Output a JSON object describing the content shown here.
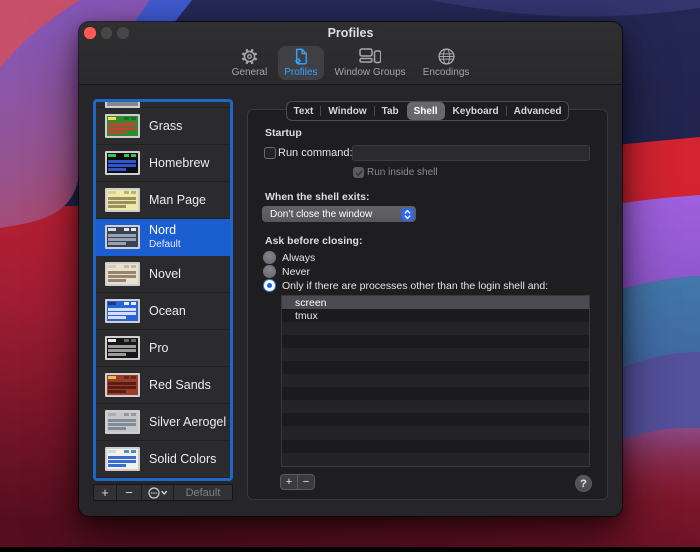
{
  "window": {
    "title": "Profiles"
  },
  "toolbar": {
    "accent_color": "#35a5ff",
    "items": [
      {
        "label": "General",
        "icon": "gear-icon",
        "selected": false
      },
      {
        "label": "Profiles",
        "icon": "profiles-doc-icon",
        "selected": true
      },
      {
        "label": "Window Groups",
        "icon": "window-groups-icon",
        "selected": false
      },
      {
        "label": "Encodings",
        "icon": "globe-icon",
        "selected": false
      }
    ]
  },
  "sidebar": {
    "selection_color": "#1b5ed2",
    "focus_ring_color": "#1e66c9",
    "profiles": [
      {
        "name": "Grass",
        "selected": false,
        "thumb": {
          "bg": "#2e8b33",
          "stripe": "#c0452e",
          "pill": "#ffe14a",
          "chip": "#1f6f24"
        }
      },
      {
        "name": "Homebrew",
        "selected": false,
        "thumb": {
          "bg": "#0d0d0d",
          "stripe": "#2f55cf",
          "pill": "#2fc84a",
          "chip": "#2fc84a"
        }
      },
      {
        "name": "Man Page",
        "selected": false,
        "thumb": {
          "bg": "#f0eaa4",
          "stripe": "#97915f",
          "pill": "#d8d292",
          "chip": "#b8b27a"
        }
      },
      {
        "name": "Nord",
        "subtitle": "Default",
        "selected": true,
        "thumb": {
          "bg": "#3b4252",
          "stripe": "#97a1b4",
          "pill": "#d8dee9",
          "chip": "#e5e9f0"
        }
      },
      {
        "name": "Novel",
        "selected": false,
        "thumb": {
          "bg": "#e9e1cb",
          "stripe": "#94846e",
          "pill": "#d3c9ae",
          "chip": "#c4b896"
        }
      },
      {
        "name": "Ocean",
        "selected": false,
        "thumb": {
          "bg": "#2a62d9",
          "stripe": "#d4def5",
          "pill": "#16388e",
          "chip": "#e8eefc"
        }
      },
      {
        "name": "Pro",
        "selected": false,
        "thumb": {
          "bg": "#161616",
          "stripe": "#9a9a9a",
          "pill": "#e8e8e8",
          "chip": "#6a6a6a"
        }
      },
      {
        "name": "Red Sands",
        "selected": false,
        "thumb": {
          "bg": "#9e3c2b",
          "stripe": "#571f14",
          "pill": "#e5c44a",
          "chip": "#6e2417"
        }
      },
      {
        "name": "Silver Aerogel",
        "selected": false,
        "thumb": {
          "bg": "#c7c7c7",
          "stripe": "#7f8b99",
          "pill": "#a9aeb4",
          "chip": "#8f9aa6"
        }
      },
      {
        "name": "Solid Colors",
        "selected": false,
        "thumb": {
          "bg": "#f3f1ec",
          "stripe": "#3a6bd1",
          "pill": "#d8d8d8",
          "chip": "#4a8ad8"
        }
      }
    ],
    "buttons": {
      "add": "+",
      "remove": "−",
      "action": "ellipsis-circle-chevron",
      "default_label": "Default"
    }
  },
  "tabs": {
    "items": [
      "Text",
      "Window",
      "Tab",
      "Shell",
      "Keyboard",
      "Advanced"
    ],
    "selected": "Shell"
  },
  "shell_pane": {
    "startup_heading": "Startup",
    "run_command_label": "Run command:",
    "run_command_value": "",
    "run_command_checked": false,
    "run_inside_shell_label": "Run inside shell",
    "run_inside_shell_checked": true,
    "shell_exits_heading": "When the shell exits:",
    "shell_exits_value": "Don’t close the window",
    "ask_heading": "Ask before closing:",
    "radios": [
      {
        "label": "Always",
        "selected": false
      },
      {
        "label": "Never",
        "selected": false
      },
      {
        "label": "Only if there are processes other than the login shell and:",
        "selected": true
      }
    ],
    "process_list": {
      "items": [
        "screen",
        "tmux"
      ],
      "selected_index": 0,
      "empty_rows": 11
    },
    "add_label": "+",
    "remove_label": "−",
    "help_label": "?"
  }
}
